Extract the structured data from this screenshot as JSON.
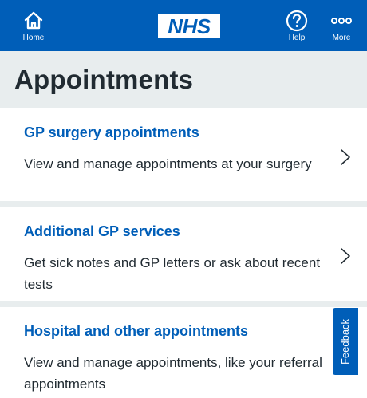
{
  "topbar": {
    "home_label": "Home",
    "logo_text": "NHS",
    "help_label": "Help",
    "more_label": "More"
  },
  "page": {
    "title": "Appointments"
  },
  "cards": [
    {
      "title": "GP surgery appointments",
      "description": "View and manage appointments at your surgery"
    },
    {
      "title": "Additional GP services",
      "description": "Get sick notes and GP letters or ask about recent tests"
    },
    {
      "title": "Hospital and other appointments",
      "description": "View and manage appointments, like your referral appointments"
    }
  ],
  "feedback": {
    "label": "Feedback"
  },
  "colors": {
    "nhs_blue": "#005eb8",
    "background": "#e8edee",
    "text": "#212b32",
    "card": "#ffffff"
  },
  "icons": {
    "home": "home-icon",
    "help": "help-circle-icon",
    "more": "more-dots-icon",
    "card_chevron": "chevron-right-icon"
  }
}
